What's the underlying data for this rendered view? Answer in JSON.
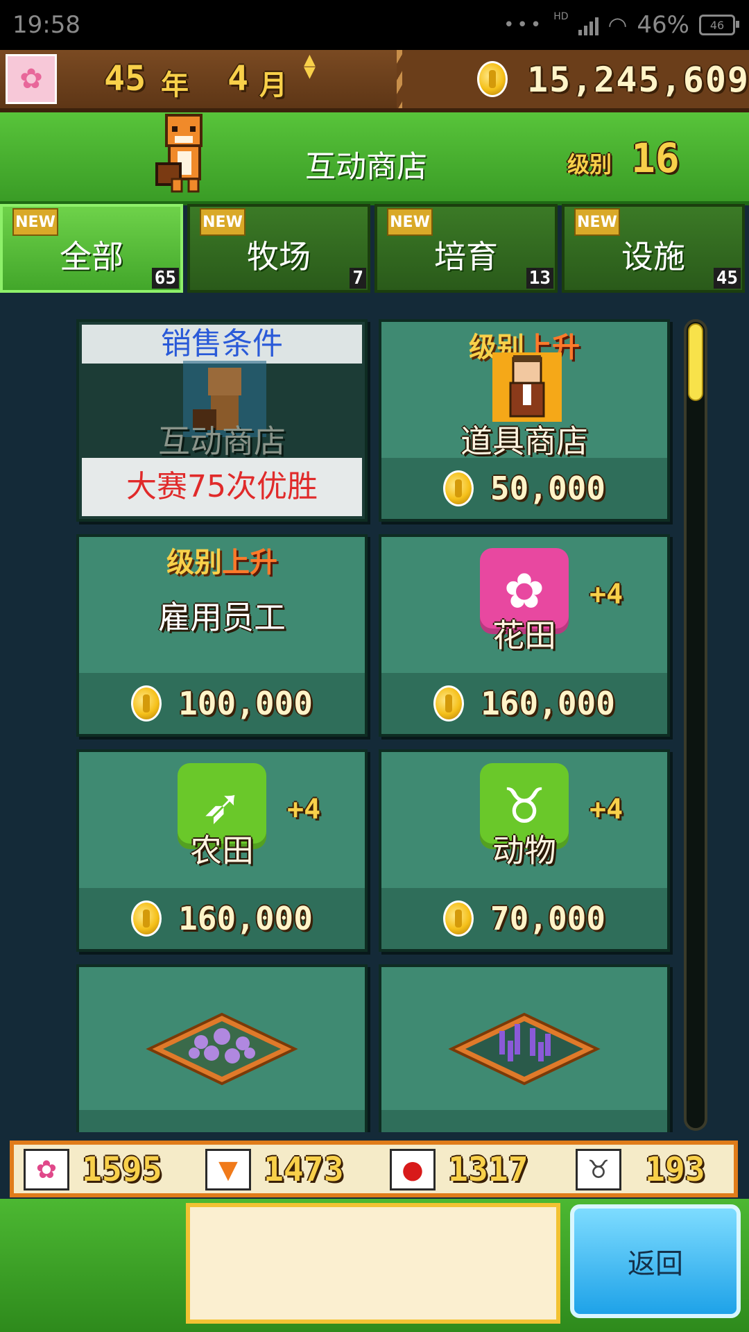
{
  "status_bar": {
    "time": "19:58",
    "network": "HD",
    "battery_pct": "46%",
    "battery_badge": "46"
  },
  "top_bar": {
    "year": "45",
    "year_unit": "年",
    "month": "4",
    "month_unit": "月",
    "money": "15,245,609"
  },
  "header": {
    "title": "互动商店",
    "level_label": "级别",
    "level_value": "16"
  },
  "tabs": [
    {
      "label": "全部",
      "badge": "NEW",
      "count": "65",
      "active": true
    },
    {
      "label": "牧场",
      "badge": "NEW",
      "count": "7",
      "active": false
    },
    {
      "label": "培育",
      "badge": "NEW",
      "count": "13",
      "active": false
    },
    {
      "label": "设施",
      "badge": "NEW",
      "count": "45",
      "active": false
    }
  ],
  "cards": {
    "c1": {
      "overlay_top": "销售条件",
      "name": "互动商店",
      "overlay_bottom": "大赛75次优胜"
    },
    "c2": {
      "lvup_a": "级别",
      "lvup_b": "上升",
      "name": "道具商店",
      "price": "50,000"
    },
    "c3": {
      "lvup_a": "级别",
      "lvup_b": "上升",
      "name": "雇用员工",
      "price": "100,000"
    },
    "c4": {
      "name": "花田",
      "plus": "+4",
      "price": "160,000"
    },
    "c5": {
      "name": "农田",
      "plus": "+4",
      "price": "160,000"
    },
    "c6": {
      "name": "动物",
      "plus": "+4",
      "price": "70,000"
    }
  },
  "resources": [
    {
      "icon": "flower-icon",
      "value": "1595"
    },
    {
      "icon": "carrot-icon",
      "value": "1473"
    },
    {
      "icon": "apple-icon",
      "value": "1317"
    },
    {
      "icon": "cow-icon",
      "value": "193"
    }
  ],
  "buttons": {
    "back": "返回"
  },
  "colors": {
    "accent_green": "#58c43a",
    "coin_gold": "#f5c01a",
    "lock_text": "#e02a2a",
    "lock_title": "#2a5ad8",
    "back_button": "#1ea2e8"
  }
}
